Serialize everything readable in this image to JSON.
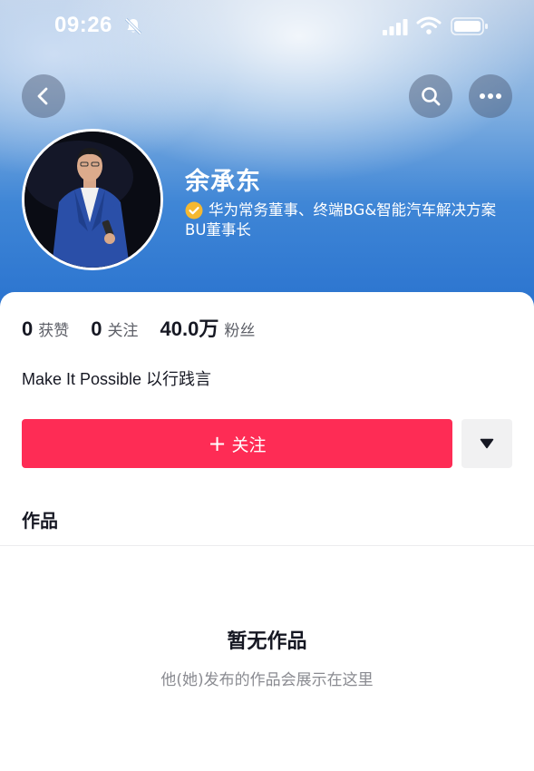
{
  "status_bar": {
    "time": "09:26",
    "icons": [
      "bell-slash-icon",
      "cellular-signal-icon",
      "wifi-icon",
      "battery-icon"
    ]
  },
  "top_nav": {
    "back_icon": "chevron-left-icon",
    "search_icon": "search-icon",
    "more_icon": "more-horizontal-icon"
  },
  "profile": {
    "name": "余承东",
    "verified_icon": "verified-badge-icon",
    "title": "华为常务董事、终端BG&智能汽车解决方案BU董事长",
    "bio": "Make It Possible 以行践言"
  },
  "stats": [
    {
      "value": "0",
      "label": "获赞"
    },
    {
      "value": "0",
      "label": "关注"
    },
    {
      "value": "40.0万",
      "label": "粉丝"
    }
  ],
  "actions": {
    "follow_plus": "+",
    "follow_label": "关注",
    "dropdown_icon": "caret-down-icon"
  },
  "works": {
    "heading": "作品",
    "empty_title": "暂无作品",
    "empty_subtitle": "他(她)发布的作品会展示在这里"
  },
  "colors": {
    "accent": "#fe2c55",
    "verified": "#f5b830",
    "header_blue": "#2a73cf"
  }
}
